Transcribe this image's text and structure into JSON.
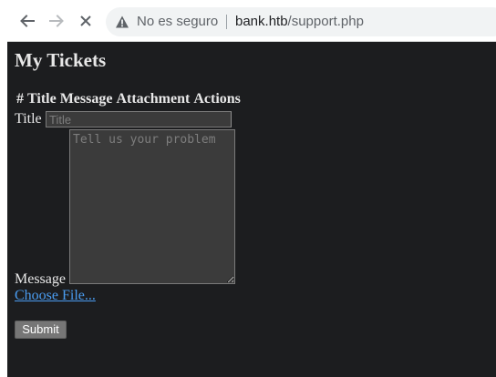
{
  "browser": {
    "security_label": "No es seguro",
    "url_host": "bank.htb",
    "url_path": "/support.php",
    "icons": {
      "back": "arrow-left-icon",
      "forward": "arrow-right-icon",
      "reload": "close-icon",
      "security": "warning-icon"
    }
  },
  "page": {
    "title": "My Tickets",
    "table_headers": [
      "#",
      "Title",
      "Message",
      "Attachment",
      "Actions"
    ],
    "form": {
      "title_label": "Title",
      "title_placeholder": "Title",
      "message_label": "Message",
      "message_placeholder": "Tell us your problem",
      "file_button": "Choose File...",
      "submit_label": "Submit"
    }
  },
  "colors": {
    "page_background": "#1c1d1f",
    "text": "#e8e8e8",
    "link": "#4a9cf0",
    "input_background": "#3b3b3b",
    "button_background": "#767676"
  }
}
